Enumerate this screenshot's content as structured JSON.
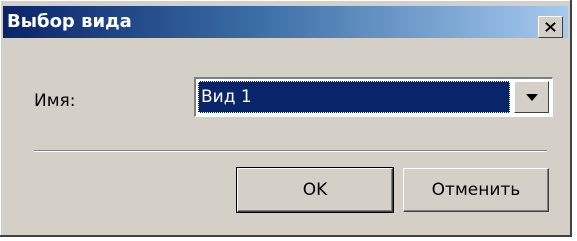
{
  "dialog": {
    "title": "Выбор вида",
    "close_icon": "close-icon"
  },
  "form": {
    "name_label": "Имя:",
    "name_value": "Вид 1",
    "dropdown_icon": "chevron-down-icon"
  },
  "buttons": {
    "ok_label": "OK",
    "cancel_label": "Отменить"
  },
  "colors": {
    "titlebar_start": "#0a246a",
    "titlebar_end": "#a6caf0",
    "selection": "#0a246a",
    "face": "#d4d0c8"
  }
}
